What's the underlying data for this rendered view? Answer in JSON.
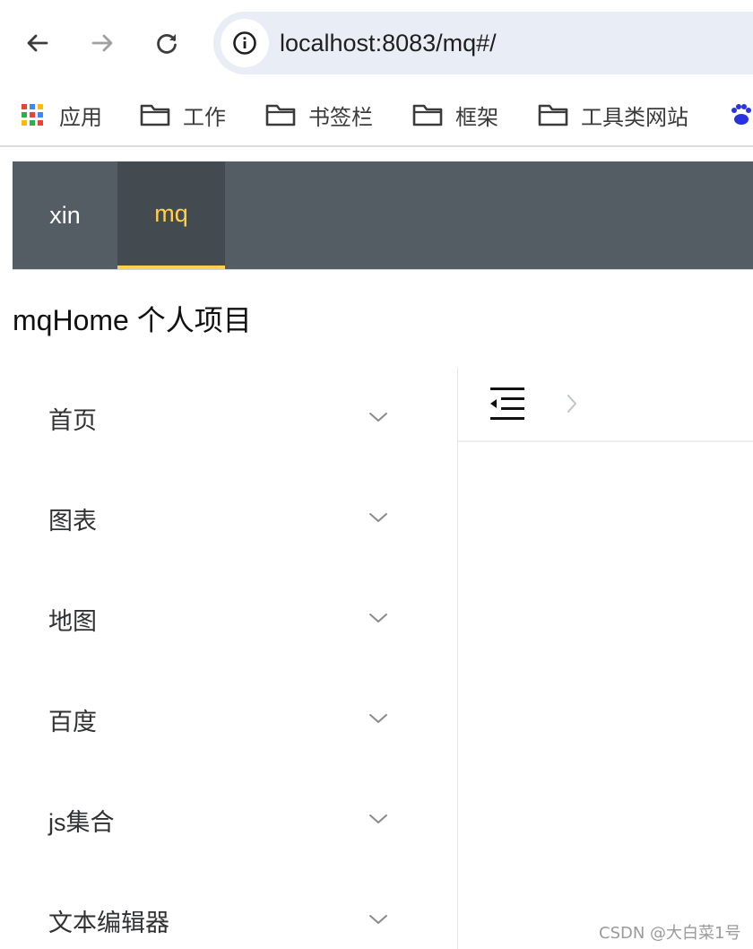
{
  "browser": {
    "url": "localhost:8083/mq#/",
    "nav_icons": [
      "back-arrow-icon",
      "forward-arrow-icon",
      "reload-icon",
      "site-info-icon"
    ]
  },
  "bookmarks_bar": {
    "items": [
      {
        "label": "应用",
        "icon": "apps-grid-icon"
      },
      {
        "label": "工作",
        "icon": "folder-icon"
      },
      {
        "label": "书签栏",
        "icon": "folder-icon"
      },
      {
        "label": "框架",
        "icon": "folder-icon"
      },
      {
        "label": "工具类网站",
        "icon": "folder-icon"
      },
      {
        "label": "",
        "icon": "baidu-paw-icon"
      }
    ]
  },
  "app_nav": {
    "tabs": [
      {
        "label": "xin",
        "active": false
      },
      {
        "label": "mq",
        "active": true
      }
    ],
    "colors": {
      "background": "#545c64",
      "active_background": "#434a50",
      "active_text": "#ffd04b",
      "text": "#ffffff"
    }
  },
  "page": {
    "title": "mqHome 个人项目"
  },
  "sidebar": {
    "items": [
      {
        "label": "首页",
        "icon": "chevron-down-icon"
      },
      {
        "label": "图表",
        "icon": "chevron-down-icon"
      },
      {
        "label": "地图",
        "icon": "chevron-down-icon"
      },
      {
        "label": "百度",
        "icon": "chevron-down-icon"
      },
      {
        "label": "js集合",
        "icon": "chevron-down-icon"
      },
      {
        "label": "文本编辑器",
        "icon": "chevron-down-icon"
      }
    ]
  },
  "content_header": {
    "icons": [
      "collapse-menu-icon",
      "breadcrumb-separator-icon"
    ]
  },
  "watermark": "CSDN @大白菜1号"
}
